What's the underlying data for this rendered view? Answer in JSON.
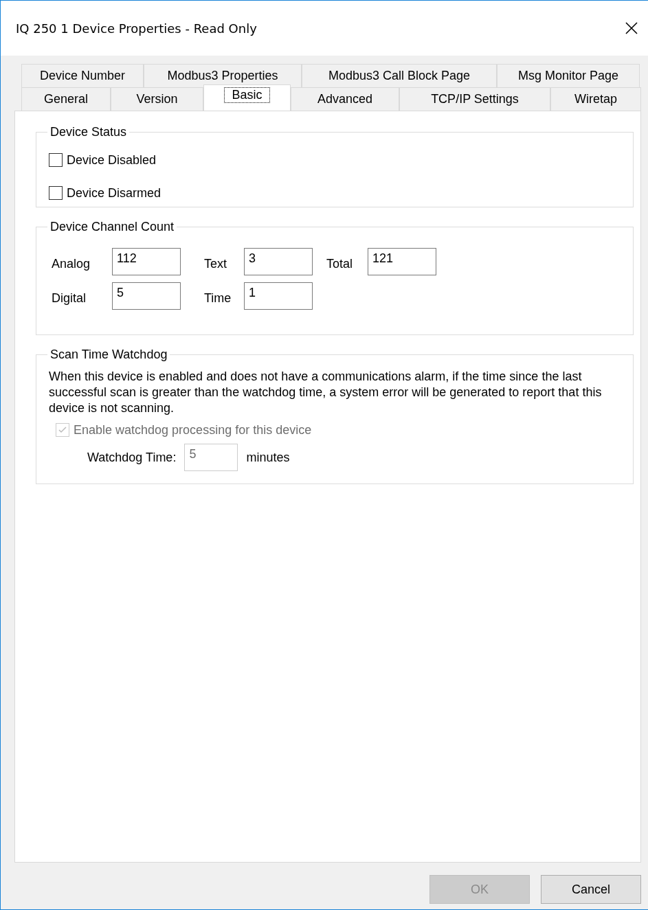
{
  "window": {
    "title": "IQ 250 1 Device Properties - Read Only"
  },
  "tab_rows": [
    {
      "tabs": [
        {
          "label": "Device Number",
          "selected": false
        },
        {
          "label": "Modbus3 Properties",
          "selected": false
        },
        {
          "label": "Modbus3 Call Block Page",
          "selected": false
        },
        {
          "label": "Msg Monitor Page",
          "selected": false
        }
      ]
    },
    {
      "tabs": [
        {
          "label": "General",
          "selected": false
        },
        {
          "label": "Version",
          "selected": false
        },
        {
          "label": "Basic",
          "selected": true
        },
        {
          "label": "Advanced",
          "selected": false
        },
        {
          "label": "TCP/IP Settings",
          "selected": false
        },
        {
          "label": "Wiretap",
          "selected": false
        }
      ]
    }
  ],
  "device_status": {
    "title": "Device Status",
    "checkboxes": [
      {
        "label": "Device Disabled",
        "checked": false
      },
      {
        "label": "Device Disarmed",
        "checked": false
      }
    ]
  },
  "channel_count": {
    "title": "Device Channel Count",
    "fields": [
      {
        "label": "Analog",
        "value": "112"
      },
      {
        "label": "Text",
        "value": "3"
      },
      {
        "label": "Total",
        "value": "121"
      },
      {
        "label": "Digital",
        "value": "5"
      },
      {
        "label": "Time",
        "value": "1"
      }
    ]
  },
  "watchdog": {
    "title": "Scan Time Watchdog",
    "description": "When this device is enabled and does not have a communications alarm, if the time since the last successful scan is greater than the watchdog time, a system error will be generated to report that this device is not scanning.",
    "enable": {
      "label": "Enable watchdog processing for this device",
      "checked": true,
      "disabled": true
    },
    "time": {
      "label": "Watchdog Time:",
      "value": "5",
      "unit": "minutes",
      "disabled": true
    }
  },
  "buttons": [
    {
      "label": "OK",
      "disabled": true
    },
    {
      "label": "Cancel",
      "disabled": false
    }
  ]
}
